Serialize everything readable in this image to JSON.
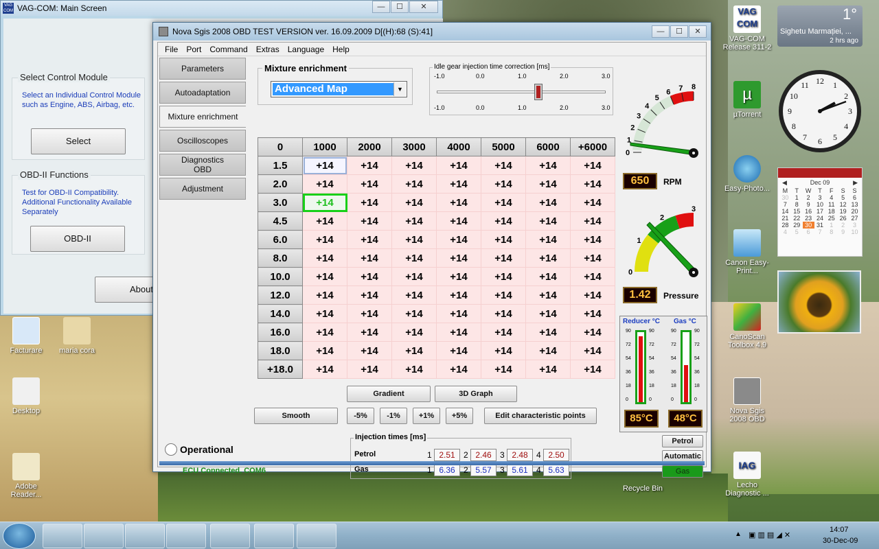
{
  "desktop": {
    "icons_right": [
      {
        "label": "VAG-COM Release 311-2"
      },
      {
        "label": "µTorrent"
      },
      {
        "label": "Easy-Photo..."
      },
      {
        "label": "Canon Easy-Print..."
      },
      {
        "label": "CanoScan Toolbox 4.9"
      },
      {
        "label": "Nova Sgis 2008 OBD"
      },
      {
        "label": "Lecho Diagnostic ..."
      }
    ],
    "icons_left": [
      {
        "label": "Facturare"
      },
      {
        "label": "maria cora"
      },
      {
        "label": "Desktop"
      },
      {
        "label": "Adobe Reader..."
      }
    ],
    "recycle_bin": "Recycle Bin",
    "weather": {
      "temp": "1°",
      "city": "Sighetu Marmației, ...",
      "updated": "2 hrs ago"
    },
    "calendar": {
      "month": "Dec 09",
      "days": [
        "M",
        "T",
        "W",
        "T",
        "F",
        "S",
        "S"
      ],
      "weeks": [
        [
          "30",
          "1",
          "2",
          "3",
          "4",
          "5",
          "6"
        ],
        [
          "7",
          "8",
          "9",
          "10",
          "11",
          "12",
          "13"
        ],
        [
          "14",
          "15",
          "16",
          "17",
          "18",
          "19",
          "20"
        ],
        [
          "21",
          "22",
          "23",
          "24",
          "25",
          "26",
          "27"
        ],
        [
          "28",
          "29",
          "30",
          "31",
          "1",
          "2",
          "3"
        ],
        [
          "4",
          "5",
          "6",
          "7",
          "8",
          "9",
          "10"
        ]
      ]
    },
    "clock": {
      "hour_numbers": [
        "12",
        "1",
        "2",
        "3",
        "4",
        "5",
        "6",
        "7",
        "8",
        "9",
        "10",
        "11"
      ]
    }
  },
  "vagcom": {
    "title": "VAG-COM: Main Screen",
    "logo": "VAG COM",
    "select_group": {
      "title": "Select Control Module",
      "desc": "Select an Individual Control Module such as Engine, ABS, Airbag, etc.",
      "button": "Select"
    },
    "obd_group": {
      "title": "OBD-II Functions",
      "desc": "Test for OBD-II Compatibility. Additional Functionality Available Separately",
      "button": "OBD-II"
    },
    "about_button": "About"
  },
  "nova": {
    "title": "Nova Sgis 2008 OBD TEST VERSION ver. 16.09.2009 D[(H):68 (S):41]",
    "menu": [
      "File",
      "Port",
      "Command",
      "Extras",
      "Language",
      "Help"
    ],
    "tabs": [
      "Parameters",
      "Autoadaptation",
      "Mixture enrichment",
      "Oscilloscopes",
      "Diagnostics OBD",
      "Adjustment"
    ],
    "mixture_group": {
      "title": "Mixture enrichment",
      "selected": "Advanced Map"
    },
    "idle": {
      "title": "Idle gear injection time correction [ms]",
      "ticks": [
        "-1.0",
        "0.0",
        "1.0",
        "2.0",
        "3.0"
      ],
      "value": 1.4
    },
    "grid": {
      "corner": "0",
      "columns": [
        "1000",
        "2000",
        "3000",
        "4000",
        "5000",
        "6000",
        "+6000"
      ],
      "rows": [
        "1.5",
        "2.0",
        "3.0",
        "4.5",
        "6.0",
        "8.0",
        "10.0",
        "12.0",
        "14.0",
        "16.0",
        "18.0",
        "+18.0"
      ],
      "cell_value": "+14"
    },
    "buttons": {
      "gradient": "Gradient",
      "graph3d": "3D Graph",
      "smooth": "Smooth",
      "m5": "-5%",
      "m1": "-1%",
      "p1": "+1%",
      "p5": "+5%",
      "edit": "Edit characteristic points"
    },
    "rpm_gauge": {
      "ticks": [
        "0",
        "1",
        "2",
        "3",
        "4",
        "5",
        "6",
        "7",
        "8"
      ],
      "value": "650",
      "label": "RPM"
    },
    "pressure_gauge": {
      "ticks": [
        "0",
        "1",
        "2",
        "3"
      ],
      "value": "1.42",
      "label": "Pressure"
    },
    "thermo": {
      "reducer": {
        "label": "Reducer °C",
        "value": "85°C",
        "level": 0.94
      },
      "gas": {
        "label": "Gas °C",
        "value": "48°C",
        "level": 0.53
      },
      "scale": [
        "90",
        "72",
        "54",
        "36",
        "18",
        "0"
      ]
    },
    "status": {
      "operational": "Operational",
      "ecu": "ECU Connected, COM6"
    },
    "injection": {
      "title": "Injection times [ms]",
      "petrol_label": "Petrol",
      "gas_label": "Gas",
      "petrol": [
        "2.51",
        "2.46",
        "2.48",
        "2.50"
      ],
      "gas": [
        "6.36",
        "5.57",
        "5.61",
        "5.63"
      ],
      "idx": [
        "1",
        "2",
        "3",
        "4"
      ]
    },
    "fuel": {
      "petrol": "Petrol",
      "automatic": "Automatic",
      "gas": "Gas"
    }
  },
  "taskbar": {
    "time": "14:07",
    "date": "30-Dec-09"
  },
  "colors": {
    "cell_bg": "#fde6e6",
    "accent_green": "#18d018",
    "selection_blue": "#3399ff"
  }
}
